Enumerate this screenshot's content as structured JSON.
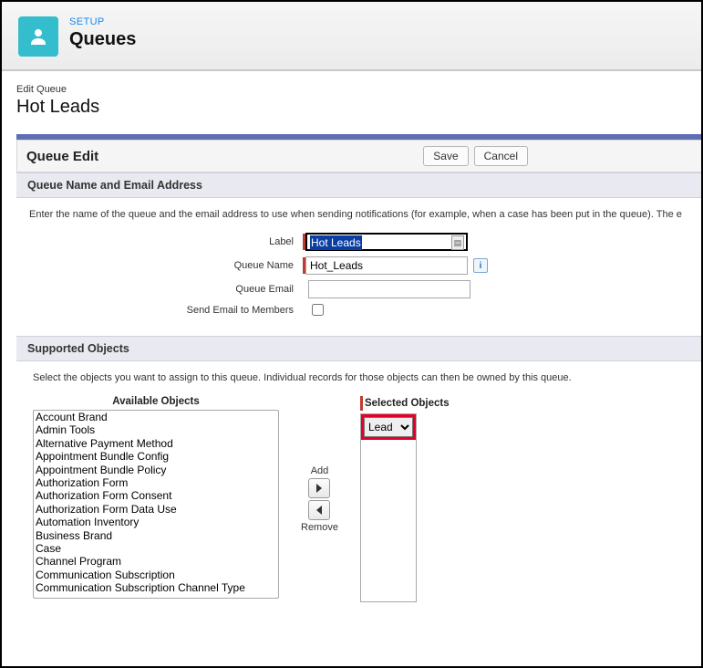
{
  "header": {
    "setup_label": "SETUP",
    "title": "Queues",
    "icon": "person-icon"
  },
  "breadcrumb": {
    "edit_queue": "Edit Queue",
    "name": "Hot Leads"
  },
  "panel": {
    "title": "Queue Edit",
    "save_label": "Save",
    "cancel_label": "Cancel"
  },
  "section_name_email": {
    "heading": "Queue Name and Email Address",
    "help": "Enter the name of the queue and the email address to use when sending notifications (for example, when a case has been put in the queue). The e",
    "label_label": "Label",
    "label_value": "Hot Leads",
    "queue_name_label": "Queue Name",
    "queue_name_value": "Hot_Leads",
    "queue_email_label": "Queue Email",
    "queue_email_value": "",
    "send_email_label": "Send Email to Members",
    "send_email_checked": false
  },
  "section_supported": {
    "heading": "Supported Objects",
    "help": "Select the objects you want to assign to this queue. Individual records for those objects can then be owned by this queue.",
    "available_title": "Available Objects",
    "selected_title": "Selected Objects",
    "add_label": "Add",
    "remove_label": "Remove",
    "available": [
      "Account Brand",
      "Admin Tools",
      "Alternative Payment Method",
      "Appointment Bundle Config",
      "Appointment Bundle Policy",
      "Authorization Form",
      "Authorization Form Consent",
      "Authorization Form Data Use",
      "Automation Inventory",
      "Business Brand",
      "Case",
      "Channel Program",
      "Communication Subscription",
      "Communication Subscription Channel Type"
    ],
    "selected": [
      "Lead"
    ]
  }
}
